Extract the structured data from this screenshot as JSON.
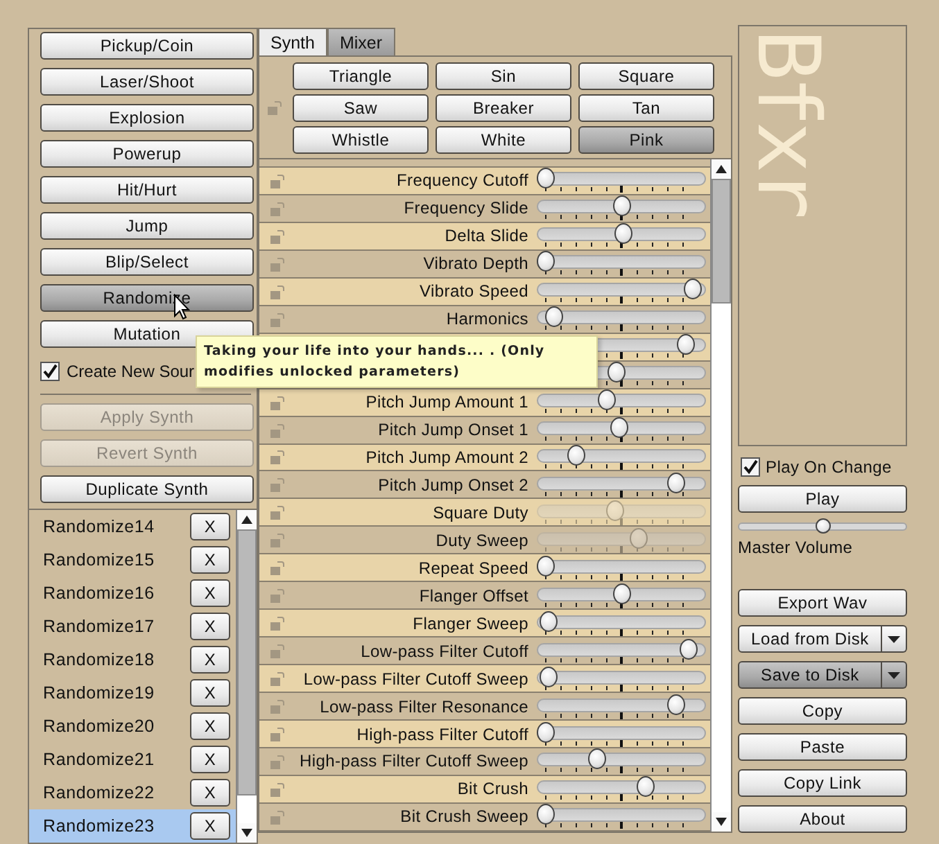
{
  "presets": [
    {
      "label": "Pickup/Coin",
      "pressed": false
    },
    {
      "label": "Laser/Shoot",
      "pressed": false
    },
    {
      "label": "Explosion",
      "pressed": false
    },
    {
      "label": "Powerup",
      "pressed": false
    },
    {
      "label": "Hit/Hurt",
      "pressed": false
    },
    {
      "label": "Jump",
      "pressed": false
    },
    {
      "label": "Blip/Select",
      "pressed": false
    },
    {
      "label": "Randomize",
      "pressed": true
    },
    {
      "label": "Mutation",
      "pressed": false
    }
  ],
  "create_new_sound": {
    "label": "Create New Sour",
    "checked": true
  },
  "synth_buttons": [
    {
      "label": "Apply Synth",
      "disabled": true
    },
    {
      "label": "Revert Synth",
      "disabled": true
    },
    {
      "label": "Duplicate Synth",
      "disabled": false
    }
  ],
  "sounds": [
    {
      "name": "Randomize14",
      "delete": "X",
      "selected": false
    },
    {
      "name": "Randomize15",
      "delete": "X",
      "selected": false
    },
    {
      "name": "Randomize16",
      "delete": "X",
      "selected": false
    },
    {
      "name": "Randomize17",
      "delete": "X",
      "selected": false
    },
    {
      "name": "Randomize18",
      "delete": "X",
      "selected": false
    },
    {
      "name": "Randomize19",
      "delete": "X",
      "selected": false
    },
    {
      "name": "Randomize20",
      "delete": "X",
      "selected": false
    },
    {
      "name": "Randomize21",
      "delete": "X",
      "selected": false
    },
    {
      "name": "Randomize22",
      "delete": "X",
      "selected": false
    },
    {
      "name": "Randomize23",
      "delete": "X",
      "selected": true
    }
  ],
  "tabs": [
    {
      "label": "Synth",
      "selected": true
    },
    {
      "label": "Mixer",
      "selected": false
    }
  ],
  "waveforms": [
    {
      "label": "Triangle",
      "selected": false
    },
    {
      "label": "Sin",
      "selected": false
    },
    {
      "label": "Square",
      "selected": false
    },
    {
      "label": "Saw",
      "selected": false
    },
    {
      "label": "Breaker",
      "selected": false
    },
    {
      "label": "Tan",
      "selected": false
    },
    {
      "label": "Whistle",
      "selected": false
    },
    {
      "label": "White",
      "selected": false
    },
    {
      "label": "Pink",
      "selected": true
    }
  ],
  "params": [
    {
      "label": "Frequency Cutoff",
      "level": 0.0,
      "disabled": false
    },
    {
      "label": "Frequency Slide",
      "level": 0.5,
      "disabled": false
    },
    {
      "label": "Delta Slide",
      "level": 0.51,
      "disabled": false
    },
    {
      "label": "Vibrato Depth",
      "level": 0.0,
      "disabled": false
    },
    {
      "label": "Vibrato Speed",
      "level": 0.97,
      "disabled": false
    },
    {
      "label": "Harmonics",
      "level": 0.05,
      "disabled": false
    },
    {
      "level": 0.93,
      "disabled": false
    },
    {
      "level": 0.47,
      "disabled": false
    },
    {
      "label": "Pitch Jump Amount 1",
      "level": 0.4,
      "disabled": false
    },
    {
      "label": "Pitch Jump Onset 1",
      "level": 0.49,
      "disabled": false
    },
    {
      "label": "Pitch Jump Amount 2",
      "level": 0.2,
      "disabled": false
    },
    {
      "label": "Pitch Jump Onset 2",
      "level": 0.86,
      "disabled": false
    },
    {
      "label": "Square Duty",
      "level": 0.46,
      "disabled": true
    },
    {
      "label": "Duty Sweep",
      "level": 0.61,
      "disabled": true
    },
    {
      "label": "Repeat Speed",
      "level": 0.0,
      "disabled": false
    },
    {
      "label": "Flanger Offset",
      "level": 0.5,
      "disabled": false
    },
    {
      "label": "Flanger Sweep",
      "level": 0.02,
      "disabled": false
    },
    {
      "label": "Low-pass Filter Cutoff",
      "level": 0.94,
      "disabled": false
    },
    {
      "label": "Low-pass Filter Cutoff Sweep",
      "level": 0.02,
      "disabled": false
    },
    {
      "label": "Low-pass Filter Resonance",
      "level": 0.86,
      "disabled": false
    },
    {
      "label": "High-pass Filter Cutoff",
      "level": 0.0,
      "disabled": false
    },
    {
      "label": "High-pass Filter Cutoff Sweep",
      "level": 0.34,
      "disabled": false
    },
    {
      "label": "Bit Crush",
      "level": 0.66,
      "disabled": false
    },
    {
      "label": "Bit Crush Sweep",
      "level": 0.0,
      "disabled": false
    }
  ],
  "tooltip": "Taking your life into your hands... . (Only modifies unlocked parameters)",
  "logo": "Bfxr",
  "play_on_change": {
    "label": "Play On Change",
    "checked": true
  },
  "play_button": "Play",
  "master_volume": {
    "label": "Master Volume",
    "level": 0.5
  },
  "actions": [
    {
      "label": "Export Wav",
      "pressed": false,
      "dropdown": false
    },
    {
      "label": "Load from Disk",
      "pressed": false,
      "dropdown": true
    },
    {
      "label": "Save to Disk",
      "pressed": true,
      "dropdown": true
    },
    {
      "label": "Copy",
      "pressed": false,
      "dropdown": false
    },
    {
      "label": "Paste",
      "pressed": false,
      "dropdown": false
    },
    {
      "label": "Copy Link",
      "pressed": false,
      "dropdown": false
    },
    {
      "label": "About",
      "pressed": false,
      "dropdown": false
    }
  ]
}
